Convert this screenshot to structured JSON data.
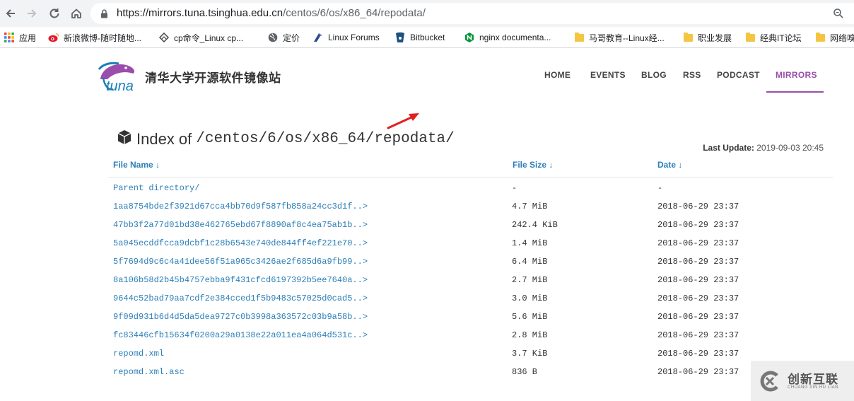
{
  "browser": {
    "url_host": "https://mirrors.tuna.tsinghua.edu.cn",
    "url_path": "/centos/6/os/x86_64/repodata/",
    "bookmarks": [
      {
        "label": "应用",
        "icon": "apps-grid-icon"
      },
      {
        "label": "新浪微博-随时随地...",
        "icon": "weibo-icon"
      },
      {
        "label": "cp命令_Linux cp...",
        "icon": "diamond-link-icon"
      },
      {
        "label": "定价",
        "icon": "globe-icon"
      },
      {
        "label": "Linux Forums",
        "icon": "linux-forums-icon"
      },
      {
        "label": "Bitbucket",
        "icon": "bitbucket-icon"
      },
      {
        "label": "nginx documenta...",
        "icon": "nginx-icon"
      },
      {
        "label": "马哥教育--Linux经...",
        "icon": "folder-icon"
      },
      {
        "label": "职业发展",
        "icon": "folder-icon"
      },
      {
        "label": "经典IT论坛",
        "icon": "folder-icon"
      },
      {
        "label": "网络嗅",
        "icon": "folder-icon"
      }
    ]
  },
  "site": {
    "logo_text": "tuna",
    "name": "清华大学开源软件镜像站",
    "nav": [
      "HOME",
      "EVENTS",
      "BLOG",
      "RSS",
      "PODCAST",
      "MIRRORS"
    ],
    "active_nav": "MIRRORS",
    "accent": "#9b4dab",
    "link_color": "#2c7fb8"
  },
  "listing": {
    "title_label": "Index of",
    "title_path": "/centos/6/os/x86_64/repodata/",
    "last_update_label": "Last Update:",
    "last_update_value": "2019-09-03 20:45",
    "columns": [
      "File Name ↓",
      "File Size ↓",
      "Date ↓"
    ],
    "rows": [
      {
        "name": "Parent directory/",
        "size": "-",
        "date": "-"
      },
      {
        "name": "1aa8754bde2f3921d67cca4bb70d9f587fb858a24cc3d1f..>",
        "size": "4.7 MiB",
        "date": "2018-06-29 23:37"
      },
      {
        "name": "47bb3f2a77d01bd38e462765ebd67f8890af8c4ea75ab1b..>",
        "size": "242.4 KiB",
        "date": "2018-06-29 23:37"
      },
      {
        "name": "5a045ecddfcca9dcbf1c28b6543e740de844ff4ef221e70..>",
        "size": "1.4 MiB",
        "date": "2018-06-29 23:37"
      },
      {
        "name": "5f7694d9c6c4a41dee56f51a965c3426ae2f685d6a9fb99..>",
        "size": "6.4 MiB",
        "date": "2018-06-29 23:37"
      },
      {
        "name": "8a106b58d2b45b4757ebba9f431cfcd6197392b5ee7640a..>",
        "size": "2.7 MiB",
        "date": "2018-06-29 23:37"
      },
      {
        "name": "9644c52bad79aa7cdf2e384cced1f5b9483c57025d0cad5..>",
        "size": "3.0 MiB",
        "date": "2018-06-29 23:37"
      },
      {
        "name": "9f09d931b6d4d5da5dea9727c0b3998a363572c03b9a58b..>",
        "size": "5.6 MiB",
        "date": "2018-06-29 23:37"
      },
      {
        "name": "fc83446cfb15634f0200a29a0138e22a011ea4a064d531c..>",
        "size": "2.8 MiB",
        "date": "2018-06-29 23:37"
      },
      {
        "name": "repomd.xml",
        "size": "3.7 KiB",
        "date": "2018-06-29 23:37"
      },
      {
        "name": "repomd.xml.asc",
        "size": "836 B",
        "date": "2018-06-29 23:37"
      }
    ]
  },
  "watermark": {
    "text": "创新互联",
    "subtext": "CHUANG XIN HU LIAN"
  }
}
